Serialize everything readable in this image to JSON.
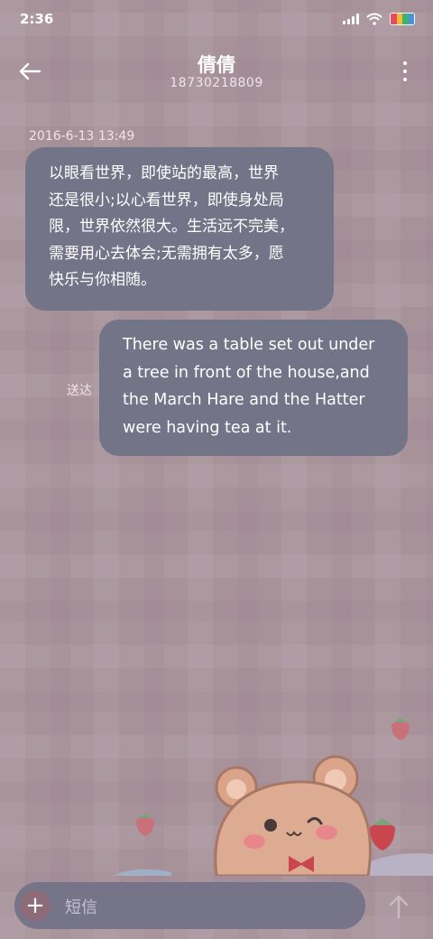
{
  "status_bar": {
    "time": "2:36",
    "icons": [
      "signal-icon",
      "wifi-icon",
      "battery-icon"
    ],
    "battery_colors": [
      "#e84a5f",
      "#f7b733",
      "#3cb371",
      "#4a90e2"
    ]
  },
  "header": {
    "back_icon": "back-arrow-icon",
    "contact_name": "倩倩",
    "phone_number": "18730218809",
    "more_icon": "more-vertical-icon"
  },
  "conversation": {
    "timestamp": "2016-6-13 13:49",
    "messages": [
      {
        "direction": "incoming",
        "lines": [
          "以眼看世界，即使站的最高，世界",
          "还是很小;以心看世界，即使身处局",
          "限，世界依然很大。生活远不完美，",
          "需要用心去体会;无需拥有太多，愿",
          "快乐与你相随。"
        ]
      },
      {
        "direction": "outgoing",
        "status": "送达",
        "lines": [
          "There was a table set out under",
          "a tree in front of the house,and",
          "the March Hare and the Hatter",
          "were having tea at it."
        ]
      }
    ]
  },
  "composer": {
    "add_icon": "plus-icon",
    "add_symbol": "+",
    "placeholder": "短信",
    "send_icon": "send-arrow-icon"
  },
  "colors": {
    "background": "#a8929a",
    "bubble": "#747488",
    "composer": "#757489",
    "add_button": "#8e6b78"
  }
}
